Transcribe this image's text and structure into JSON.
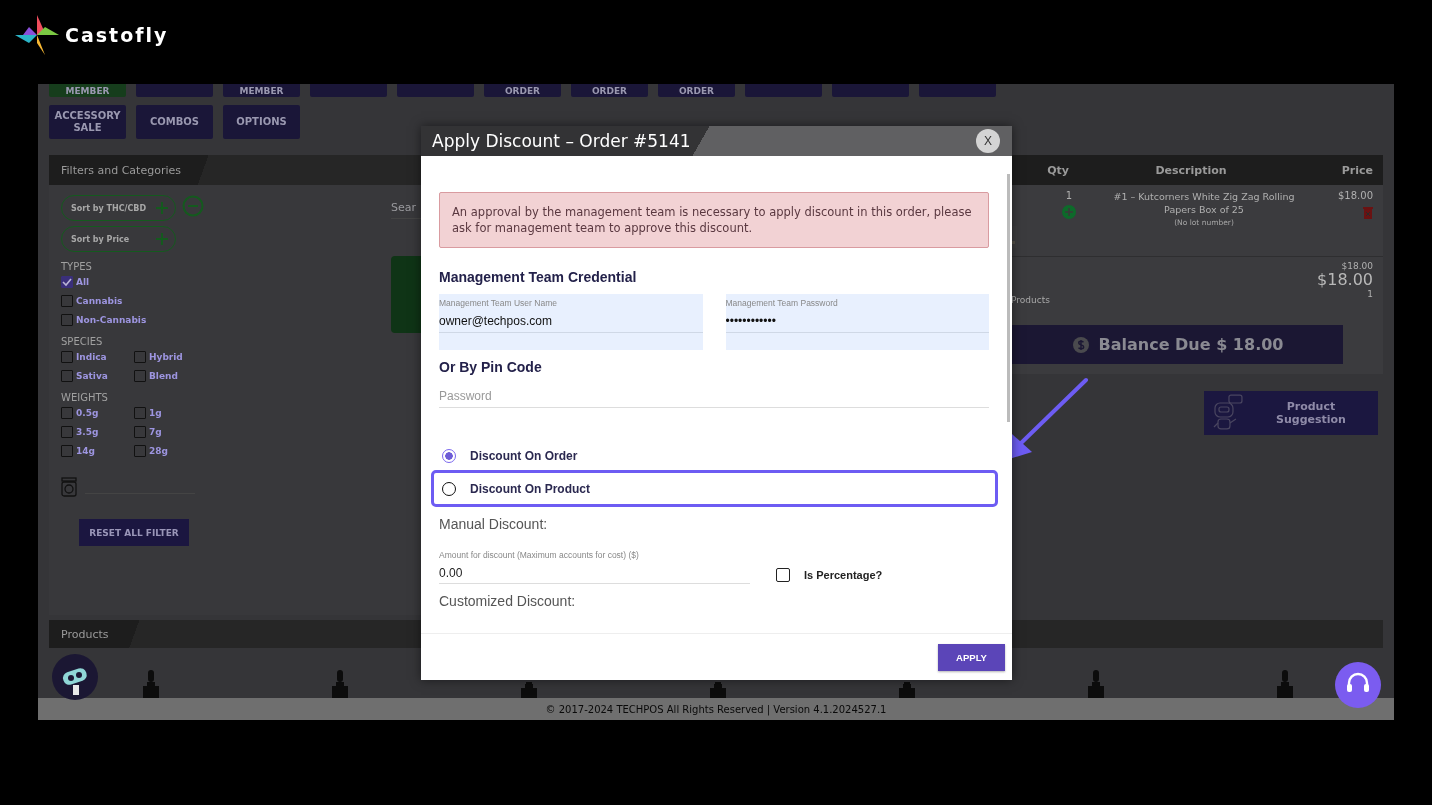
{
  "brand": {
    "name": "Castofly"
  },
  "app": {
    "buttons_row1": [
      {
        "label": "MEMBER",
        "color": "#163d1c"
      },
      {
        "color": "#1a1638"
      },
      {
        "label": "MEMBER",
        "color": "#1a1638"
      },
      {
        "color": "#1a1638"
      },
      {
        "color": "#1a1638"
      },
      {
        "label": "ORDER",
        "color": "#1a1638"
      },
      {
        "label": "ORDER",
        "color": "#1a1638"
      },
      {
        "label": "ORDER",
        "color": "#1a1638"
      },
      {
        "color": "#1a1638"
      },
      {
        "color": "#1a1638"
      },
      {
        "color": "#1a1638"
      }
    ],
    "buttons_row2": [
      "ACCESSORY SALE",
      "COMBOS",
      "OPTIONS"
    ],
    "filters": {
      "title": "Filters and Categories",
      "sorts": [
        {
          "label": "Sort by THC/CBD",
          "removable": true
        },
        {
          "label": "Sort by Price",
          "removable": false
        }
      ],
      "groups": [
        {
          "title": "TYPES",
          "kind": "single",
          "options": [
            {
              "label": "All",
              "checked": true
            },
            {
              "label": "Cannabis",
              "checked": false
            },
            {
              "label": "Non-Cannabis",
              "checked": false
            }
          ]
        },
        {
          "title": "SPECIES",
          "kind": "pair",
          "options": [
            {
              "label": "Indica",
              "checked": false
            },
            {
              "label": "Hybrid",
              "checked": false
            },
            {
              "label": "Sativa",
              "checked": false
            },
            {
              "label": "Blend",
              "checked": false
            }
          ]
        },
        {
          "title": "WEIGHTS",
          "kind": "pair",
          "options": [
            {
              "label": "0.5g",
              "checked": false
            },
            {
              "label": "1g",
              "checked": false
            },
            {
              "label": "3.5g",
              "checked": false
            },
            {
              "label": "7g",
              "checked": false
            },
            {
              "label": "14g",
              "checked": false
            },
            {
              "label": "28g",
              "checked": false
            }
          ]
        }
      ],
      "reset_button": "RESET ALL FILTER"
    },
    "search": {
      "placeholder": "Sear"
    },
    "cart": {
      "columns": [
        "Qty",
        "Description",
        "Price"
      ],
      "items": [
        {
          "qty": "1",
          "description": "#1 – Kutcorners White Zig Zag Rolling Papers Box of 25",
          "lot": "(No lot number)",
          "price": "$18.00"
        }
      ],
      "subtotal": "$18.00",
      "total": "$18.00",
      "products_label": "Products",
      "products_count": "1",
      "balance_button": "Balance Due $ 18.00"
    },
    "suggestion_button": "Product Suggestion",
    "products_title": "Products",
    "footer": "© 2017-2024 TECHPOS All Rights Reserved | Version 4.1.2024527.1"
  },
  "dialog": {
    "title": "Apply Discount – Order #5141",
    "close": "X",
    "alert": "An approval by the management team is necessary to apply discount in this order, please ask for management team to approve this discount.",
    "credential_heading": "Management Team Credential",
    "credential_fields": [
      {
        "label": "Management Team User Name",
        "value": "owner@techpos.com"
      },
      {
        "label": "Management Team Password",
        "value": "••••••••••••"
      }
    ],
    "pin_heading": "Or By Pin Code",
    "pin_field": {
      "placeholder": "Password"
    },
    "options": [
      {
        "label": "Discount On Order",
        "selected": true,
        "highlighted": false
      },
      {
        "label": "Discount On Product",
        "selected": false,
        "highlighted": true
      }
    ],
    "manual_heading": "Manual Discount:",
    "amount_field": {
      "label": "Amount for discount (Maximum accounts for cost) ($)",
      "value": "0.00"
    },
    "percentage": {
      "label": "Is Percentage?",
      "checked": false
    },
    "custom_heading": "Customized Discount:",
    "apply_button": "APPLY"
  }
}
